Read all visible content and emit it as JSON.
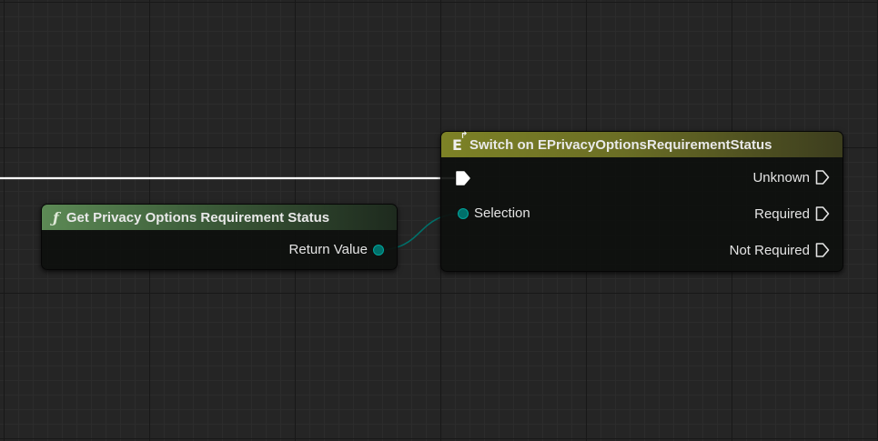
{
  "graph": {
    "function_node": {
      "title": "Get Privacy Options Requirement Status",
      "icon": "function-icon",
      "icon_glyph": "ƒ",
      "header_color": "#5c8a55",
      "output_pin": {
        "label": "Return Value",
        "color": "#00706a"
      }
    },
    "switch_node": {
      "title": "Switch on EPrivacyOptionsRequirementStatus",
      "icon": "switch-icon",
      "icon_glyph": "E",
      "header_color": "#7d8226",
      "input_pins": [
        {
          "label": "",
          "type": "exec"
        },
        {
          "label": "Selection",
          "type": "data"
        }
      ],
      "output_pins": [
        {
          "label": "Unknown",
          "type": "exec"
        },
        {
          "label": "Required",
          "type": "exec"
        },
        {
          "label": "Not Required",
          "type": "exec"
        }
      ]
    },
    "colors": {
      "exec_wire": "#ffffff",
      "data_wire": "#00706a"
    }
  }
}
